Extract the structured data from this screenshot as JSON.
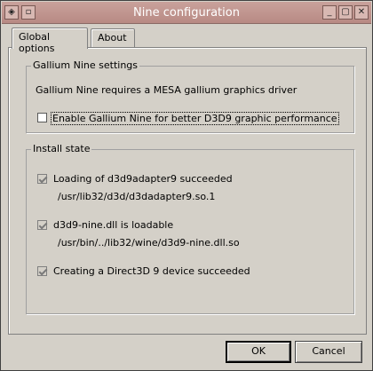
{
  "window": {
    "title": "Nine configuration",
    "buttons": {
      "menu": "◈",
      "restore": "▫",
      "minimize": "_",
      "maximize": "▢",
      "close": "✕"
    }
  },
  "tabs": [
    {
      "label": "Global options",
      "active": true
    },
    {
      "label": "About",
      "active": false
    }
  ],
  "gallium_group": {
    "label": "Gallium Nine settings",
    "requirement_text": "Gallium Nine requires a MESA gallium graphics driver",
    "enable_checkbox": {
      "label": "Enable Gallium Nine for better D3D9 graphic performance",
      "checked": false
    }
  },
  "install_group": {
    "label": "Install state",
    "items": [
      {
        "label": "Loading of d3d9adapter9 succeeded",
        "path": "/usr/lib32/d3d/d3dadapter9.so.1",
        "checked": true
      },
      {
        "label": "d3d9-nine.dll is loadable",
        "path": "/usr/bin/../lib32/wine/d3d9-nine.dll.so",
        "checked": true
      },
      {
        "label": "Creating a Direct3D 9 device succeeded",
        "path": "",
        "checked": true
      }
    ]
  },
  "dialog_buttons": {
    "ok": "OK",
    "cancel": "Cancel"
  }
}
